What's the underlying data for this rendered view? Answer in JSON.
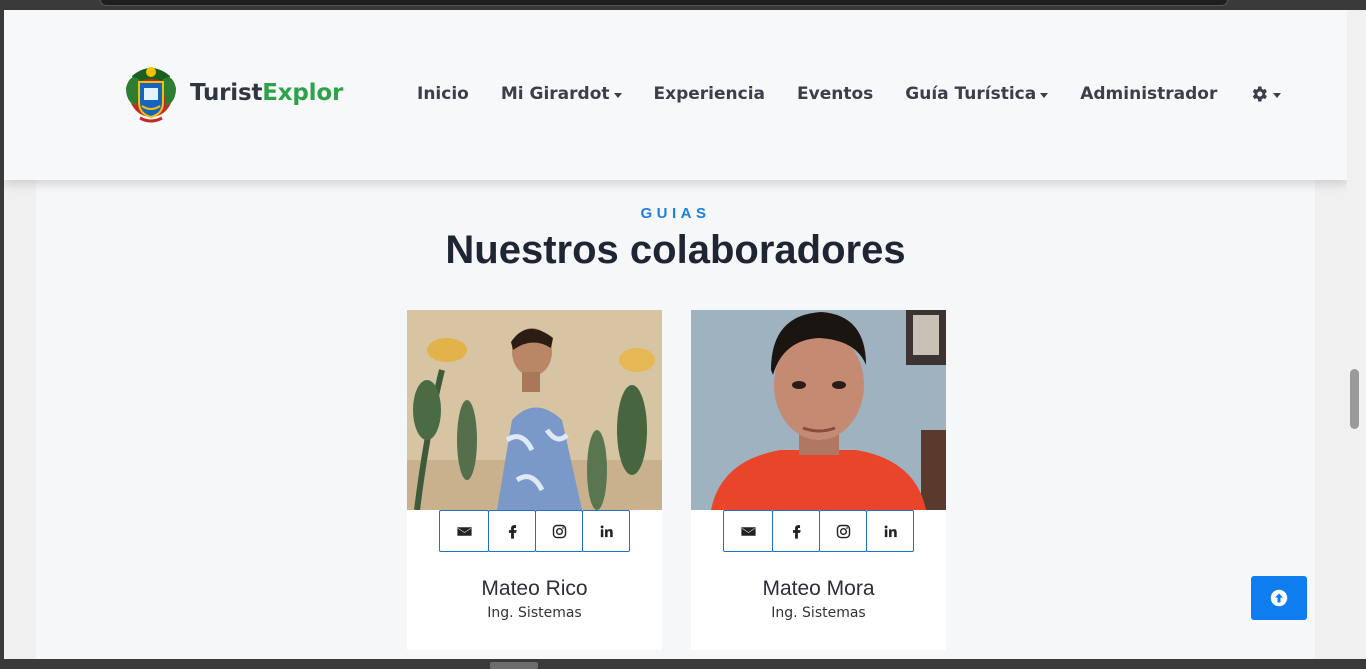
{
  "brand": {
    "name_part1": "Turist",
    "name_part2": "Explor"
  },
  "nav": {
    "items": [
      {
        "label": "Inicio",
        "dropdown": false
      },
      {
        "label": "Mi Girardot",
        "dropdown": true
      },
      {
        "label": "Experiencia",
        "dropdown": false
      },
      {
        "label": "Eventos",
        "dropdown": false
      },
      {
        "label": "Guía Turística",
        "dropdown": true
      },
      {
        "label": "Administrador",
        "dropdown": false
      }
    ],
    "settings_icon": "gear-icon"
  },
  "section": {
    "eyebrow": "GUIAS",
    "title": "Nuestros colaboradores"
  },
  "team": [
    {
      "name": "Mateo Rico",
      "role": "Ing. Sistemas"
    },
    {
      "name": "Mateo Mora",
      "role": "Ing. Sistemas"
    }
  ],
  "social_icons": [
    "envelope-icon",
    "facebook-icon",
    "instagram-icon",
    "linkedin-icon"
  ],
  "colors": {
    "accent_blue": "#1d7fe0",
    "brand_green": "#2ea24a",
    "button_blue": "#0d7df0"
  }
}
